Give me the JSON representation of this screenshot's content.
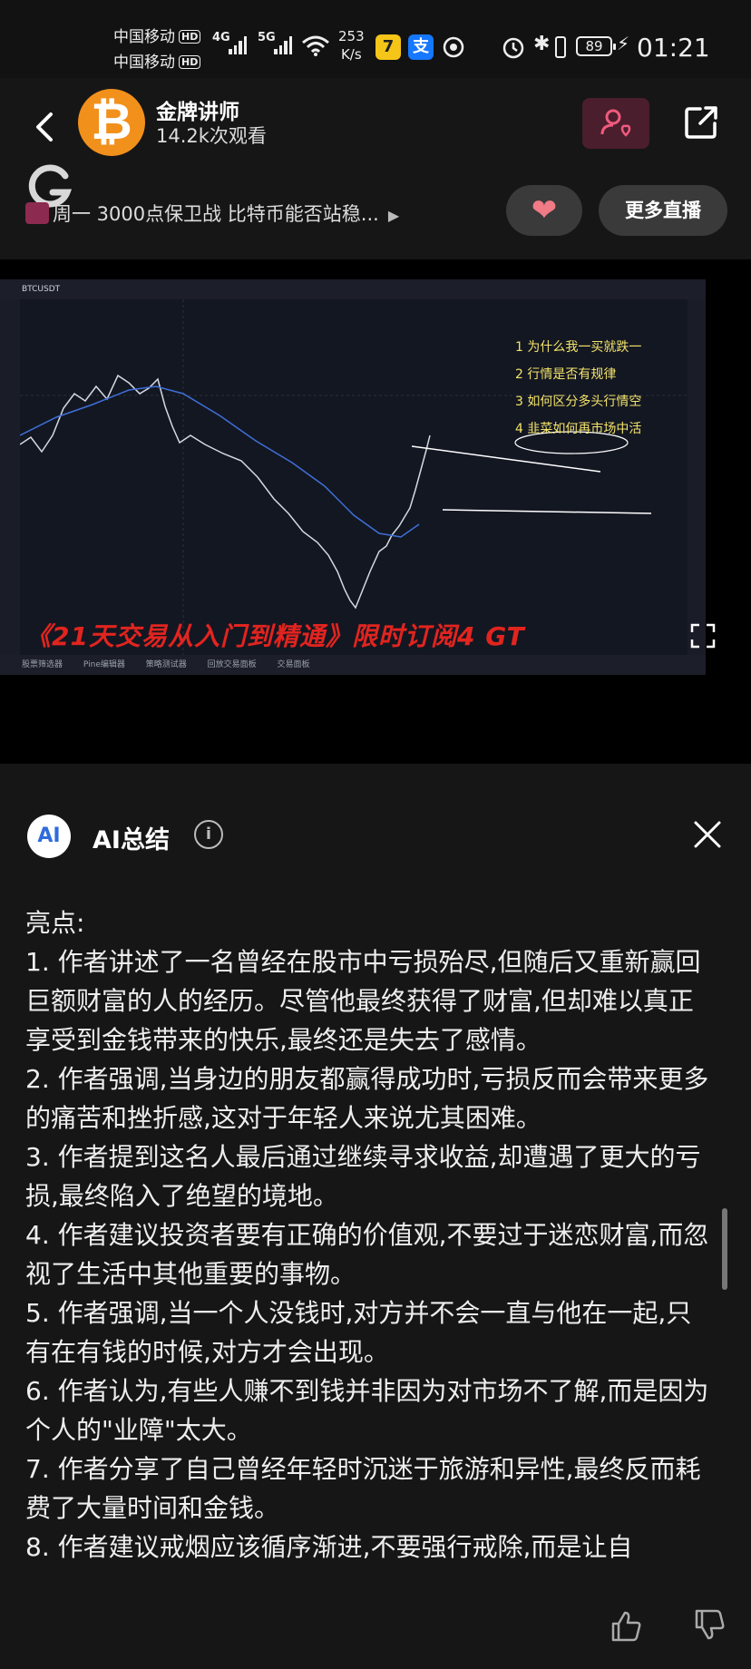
{
  "status_bar": {
    "carrier1": "中国移动",
    "carrier2": "中国移动",
    "hd": "HD",
    "net1": "4G",
    "net2": "5G",
    "speed_value": "253",
    "speed_unit": "K/s",
    "battery": "89",
    "time": "01:21"
  },
  "header": {
    "channel_name": "金牌讲师",
    "views": "14.2k次观看",
    "live_title": "周一 3000点保卫战 比特币能否站稳...",
    "more_live_label": "更多直播"
  },
  "video": {
    "symbol": "BTCUSDT",
    "annotations": [
      "1 为什么我一买就跌一",
      "2 行情是否有规律",
      "3 如何区分多头行情空",
      "4 韭菜如何再市场中活"
    ],
    "promo_banner": "《21天交易从入门到精通》限时订阅4 GT",
    "bottom_tabs": [
      "股票筛选器",
      "Pine编辑器",
      "策略测试器",
      "回放交易面板",
      "交易面板"
    ]
  },
  "summary": {
    "title": "AI总结",
    "heading": "亮点:",
    "points": [
      "1. 作者讲述了一名曾经在股市中亏损殆尽,但随后又重新赢回巨额财富的人的经历。尽管他最终获得了财富,但却难以真正享受到金钱带来的快乐,最终还是失去了感情。",
      "2. 作者强调,当身边的朋友都赢得成功时,亏损反而会带来更多的痛苦和挫折感,这对于年轻人来说尤其困难。",
      "3. 作者提到这名人最后通过继续寻求收益,却遭遇了更大的亏损,最终陷入了绝望的境地。",
      "4. 作者建议投资者要有正确的价值观,不要过于迷恋财富,而忽视了生活中其他重要的事物。",
      "5. 作者强调,当一个人没钱时,对方并不会一直与他在一起,只有在有钱的时候,对方才会出现。",
      "6. 作者认为,有些人赚不到钱并非因为对市场不了解,而是因为个人的\"业障\"太大。",
      "7. 作者分享了自己曾经年轻时沉迷于旅游和异性,最终反而耗费了大量时间和金钱。",
      "8. 作者建议戒烟应该循序渐进,不要强行戒除,而是让自"
    ]
  }
}
